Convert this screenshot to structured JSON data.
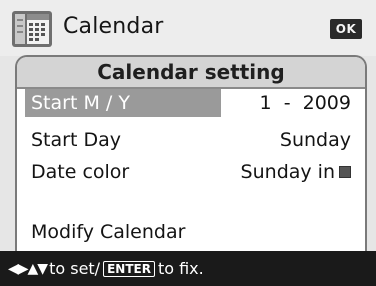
{
  "header": {
    "title": "Calendar",
    "ok_label": "OK",
    "icon": "calendar-icon"
  },
  "panel": {
    "title": "Calendar setting",
    "rows": [
      {
        "label": "Start M / Y",
        "value": "1  -  2009",
        "selected": true
      },
      {
        "label": "Start Day",
        "value": "Sunday"
      },
      {
        "label": "Date color",
        "value": "Sunday in",
        "value_icon": "color-swatch-icon"
      },
      {
        "label": "Modify Calendar",
        "value": ""
      }
    ]
  },
  "footer": {
    "arrows": "◀▶▲▼",
    "text_before": "to set/",
    "enter_label": "ENTER",
    "text_after": "to fix."
  },
  "colors": {
    "selection": "#9a9a9a",
    "panel_header": "#d4d4d4",
    "footer_bg": "#1a1a1a"
  }
}
